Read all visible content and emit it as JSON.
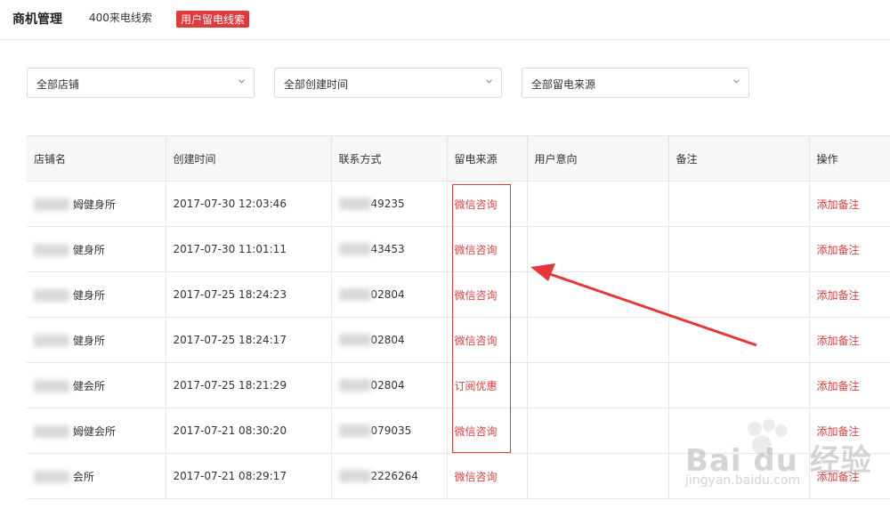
{
  "header": {
    "title": "商机管理",
    "tabs": [
      {
        "label": "400来电线索",
        "active": false
      },
      {
        "label": "用户留电线索",
        "active": true
      }
    ]
  },
  "filters": [
    {
      "label": "全部店铺"
    },
    {
      "label": "全部创建时间"
    },
    {
      "label": "全部留电来源"
    }
  ],
  "table": {
    "columns": [
      "店铺名",
      "创建时间",
      "联系方式",
      "留电来源",
      "用户意向",
      "备注",
      "操作"
    ],
    "rows": [
      {
        "store": "姆健身所",
        "time": "2017-07-30 12:03:46",
        "phone": "49235",
        "source": "微信咨询",
        "intent": "",
        "note": "",
        "action": "添加备注"
      },
      {
        "store": "健身所",
        "time": "2017-07-30 11:01:11",
        "phone": "43453",
        "source": "微信咨询",
        "intent": "",
        "note": "",
        "action": "添加备注"
      },
      {
        "store": "健身所",
        "time": "2017-07-25 18:24:23",
        "phone": "02804",
        "source": "微信咨询",
        "intent": "",
        "note": "",
        "action": "添加备注"
      },
      {
        "store": "健身所",
        "time": "2017-07-25 18:24:17",
        "phone": "02804",
        "source": "微信咨询",
        "intent": "",
        "note": "",
        "action": "添加备注"
      },
      {
        "store": "健会所",
        "time": "2017-07-25 18:21:29",
        "phone": "02804",
        "source": "订阅优惠",
        "intent": "",
        "note": "",
        "action": "添加备注"
      },
      {
        "store": "姆健会所",
        "time": "2017-07-21 08:30:20",
        "phone": "079035",
        "source": "微信咨询",
        "intent": "",
        "note": "",
        "action": "添加备注"
      },
      {
        "store": "会所",
        "time": "2017-07-21 08:29:17",
        "phone": "2226264",
        "source": "微信咨询",
        "intent": "",
        "note": "",
        "action": "添加备注"
      }
    ]
  },
  "watermark": {
    "main": "Bai du 经验",
    "sub": "jingyan.baidu.com"
  },
  "colors": {
    "accent": "#e1393c",
    "link": "#d9403f",
    "border": "#e6e6e6"
  }
}
